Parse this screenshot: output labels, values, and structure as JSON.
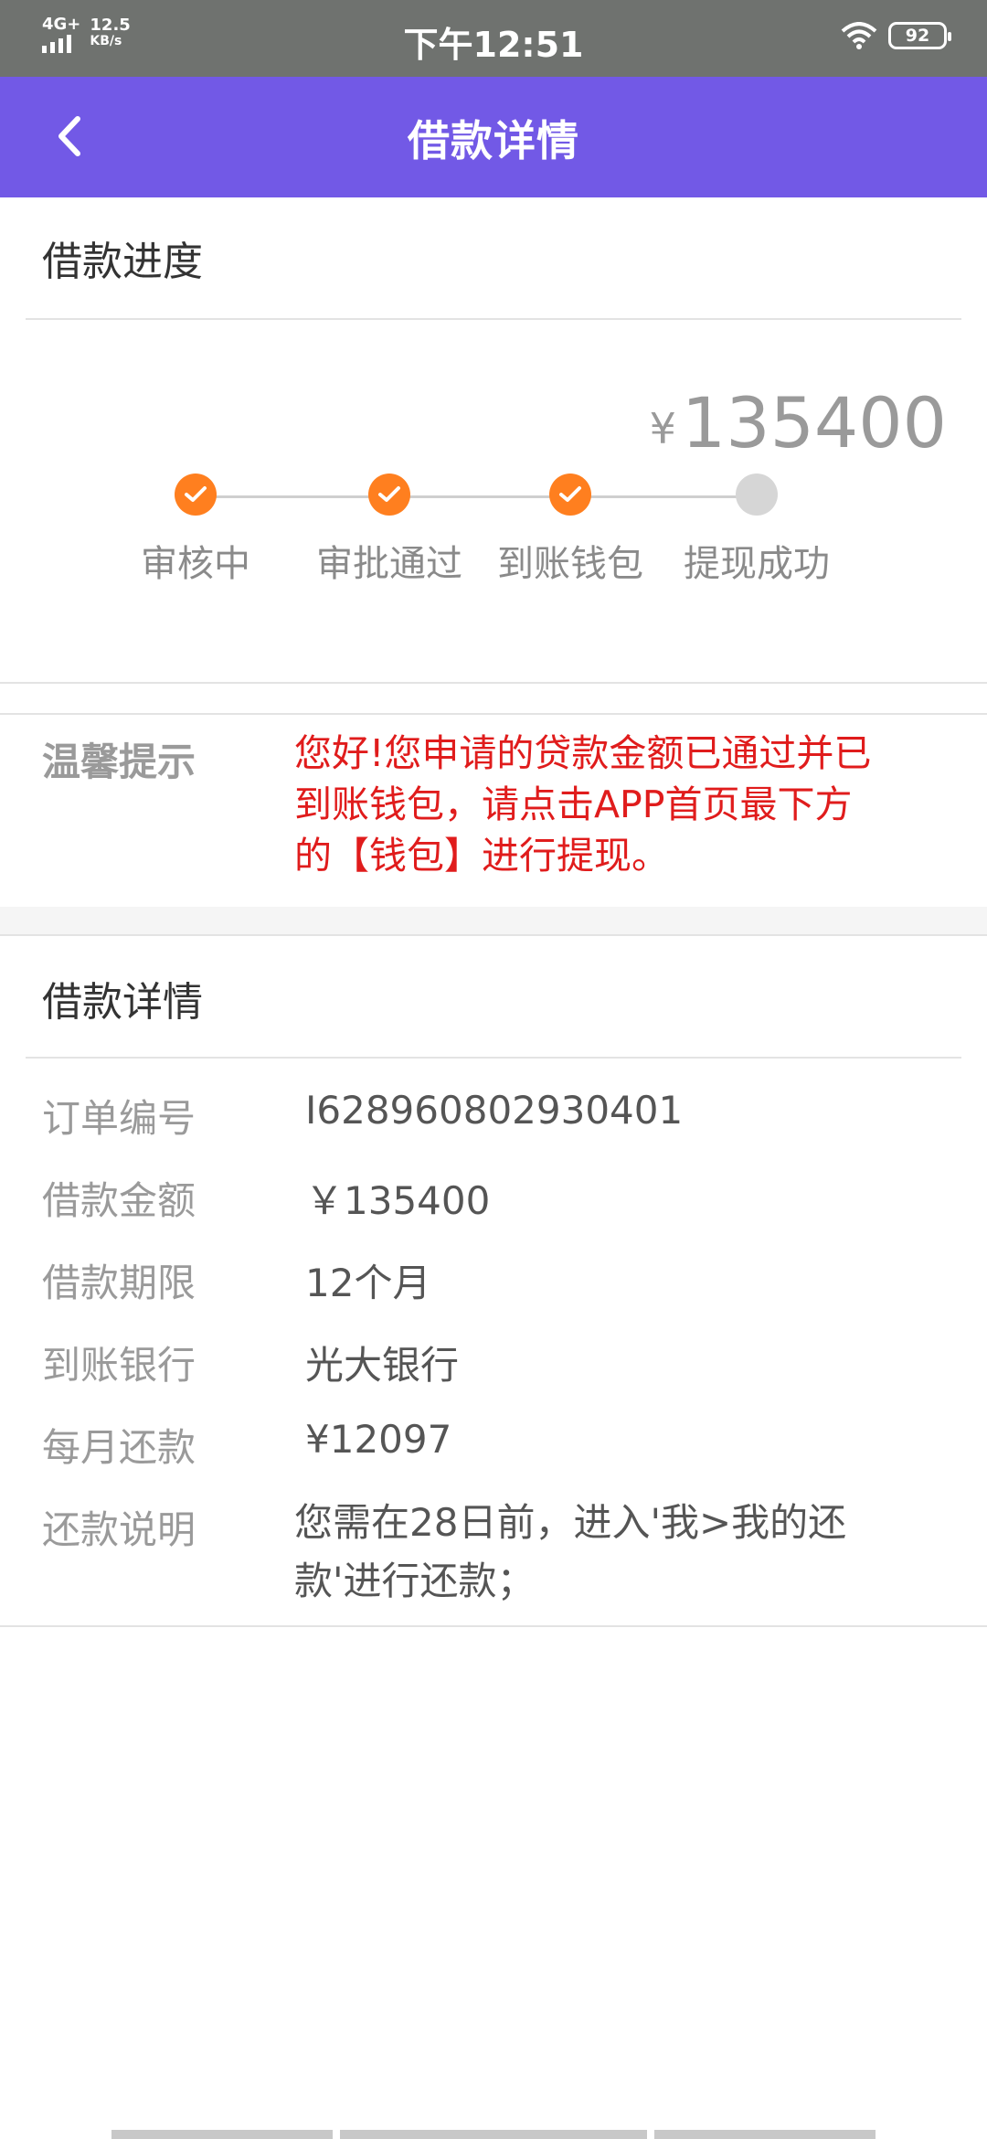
{
  "status_bar": {
    "network": "4G+",
    "speed_value": "12.5",
    "speed_unit": "KB/s",
    "time": "下午12:51",
    "battery": "92"
  },
  "header": {
    "title": "借款详情"
  },
  "progress": {
    "section_title": "借款进度",
    "amount_symbol": "¥",
    "amount_value": "135400",
    "steps": [
      {
        "label": "审核中",
        "done": true
      },
      {
        "label": "审批通过",
        "done": true
      },
      {
        "label": "到账钱包",
        "done": true
      },
      {
        "label": "提现成功",
        "done": false
      }
    ],
    "colors": {
      "done": "#ff7f1f",
      "todo": "#d6d6d6"
    }
  },
  "tip": {
    "label": "温馨提示",
    "lines": [
      "您好!您申请的贷款金额已通过并已",
      "到账钱包，请点击APP首页最下方",
      "的【钱包】进行提现。"
    ]
  },
  "details": {
    "section_title": "借款详情",
    "rows": [
      {
        "label": "订单编号",
        "value": "I628960802930401"
      },
      {
        "label": "借款金额",
        "value": "￥135400"
      },
      {
        "label": "借款期限",
        "value": "12个月"
      },
      {
        "label": "到账银行",
        "value": "光大银行"
      },
      {
        "label": "每月还款",
        "value": "¥12097"
      },
      {
        "label": "还款说明",
        "value_lines": [
          "您需在28日前，进入'我>我的还",
          "款'进行还款；"
        ]
      }
    ]
  },
  "theme": {
    "header_bg": "#7259e6",
    "status_bg": "#6f726f",
    "tip_color": "#e01c1c"
  }
}
